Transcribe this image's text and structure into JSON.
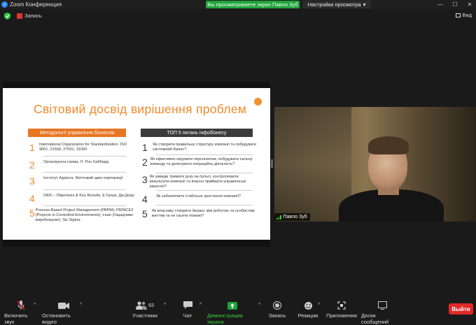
{
  "window": {
    "title": "Zoom Конференция"
  },
  "share_bar": {
    "viewing_label": "Вы просматриваете экран Павло Зуб",
    "view_options_label": "Настройки просмотра"
  },
  "topbar": {
    "recording_label": "Запись",
    "view_label": "Вид"
  },
  "slide": {
    "title": "Світовий досвід вирішення проблем",
    "left_header": "Методології управління бізнесом",
    "right_header": "ТОП 5 питань інфобізнесу",
    "left_items": [
      {
        "num": "1",
        "text": "International Organization for Standardization, ISO 9001, 21500, 27001, 31000"
      },
      {
        "num": "2",
        "text": "Організуюча схема, Л. Рон Хаббард"
      },
      {
        "num": "3",
        "text": "Інститут Адізеса, Життєвий цикл корпорації"
      },
      {
        "num": "4",
        "text": "OKR – Objectives & Key Results, Е.Гроув, Дж.Дорр"
      },
      {
        "num": "5",
        "text": "Process-Based Project Management (PBPM); PRINCE2 (Projects in Controlled Environments); Lean (Ощадливе виробництво); Six Sigma."
      }
    ],
    "right_items": [
      {
        "num": "1",
        "text": "Як створити правильну структуру компанії та побудувати системний бізнес?"
      },
      {
        "num": "2",
        "text": "Як ефективно керувати персоналом, побудувати сильну команду та делегувати операційну діяльність?"
      },
      {
        "num": "3",
        "text": "Як завжди тримати руку на пульсі, контролювати результати компанії та вчасно приймати управлінські рішення?"
      },
      {
        "num": "4",
        "text": "Як забезпечити стабільне зростання компанії?"
      },
      {
        "num": "5",
        "text": "Як власнику створити баланс між роботою та особистим життям та не гасити пожежі?"
      }
    ]
  },
  "video": {
    "participant_name": "Павло Зуб"
  },
  "toolbar": {
    "unmute_label": "Включить звук",
    "video_label": "Остановить видео",
    "participants_label": "Участники",
    "participants_count": "63",
    "chat_label": "Чат",
    "share_label": "Демонстрация экрана",
    "record_label": "Запись",
    "reactions_label": "Реакции",
    "apps_label": "Приложения",
    "whiteboard_label": "Доски сообщений",
    "leave_label": "Выйти"
  },
  "colors": {
    "accent_orange": "#f08a2c",
    "share_green": "#1fa33a",
    "leave_red": "#e02828"
  }
}
